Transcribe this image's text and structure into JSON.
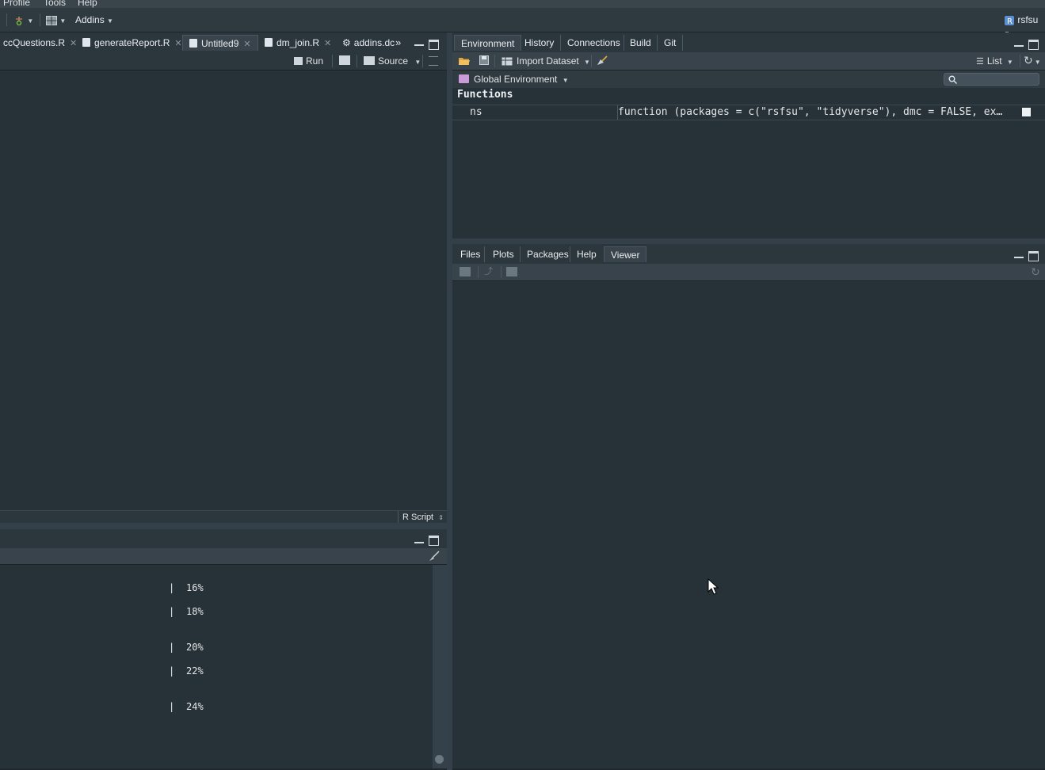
{
  "menu": {
    "items": [
      "Profile",
      "Tools",
      "Help"
    ]
  },
  "toolbar": {
    "addins_label": "Addins",
    "project_label": "rsfsu"
  },
  "source_pane": {
    "tabs": [
      {
        "label": "ccQuestions.R",
        "active": false
      },
      {
        "label": "generateReport.R",
        "active": false
      },
      {
        "label": "Untitled9",
        "active": true
      },
      {
        "label": "dm_join.R",
        "active": false
      },
      {
        "label": "addins.dc",
        "active": false
      }
    ],
    "run_label": "Run",
    "source_label": "Source",
    "file_type": "R Script"
  },
  "console_pane": {
    "lines": [
      {
        "bar": "|",
        "pct": "16%"
      },
      {
        "bar": "|",
        "pct": "18%"
      },
      {
        "bar": "|",
        "pct": "20%"
      },
      {
        "bar": "|",
        "pct": "22%"
      },
      {
        "bar": "|",
        "pct": "24%"
      }
    ]
  },
  "environment_pane": {
    "tabs": [
      "Environment",
      "History",
      "Connections",
      "Build",
      "Git"
    ],
    "active_tab": "Environment",
    "import_label": "Import Dataset",
    "view_mode": "List",
    "scope": "Global Environment",
    "section": "Functions",
    "rows": [
      {
        "name": "ns",
        "value": "function (packages = c(\"rsfsu\", \"tidyverse\"), dmc = FALSE, ex…"
      }
    ]
  },
  "viewer_pane": {
    "tabs": [
      "Files",
      "Plots",
      "Packages",
      "Help",
      "Viewer"
    ],
    "active_tab": "Viewer"
  },
  "colors": {
    "background": "#263238",
    "tabbar": "#2c363d",
    "text": "#e6e6e6"
  },
  "icons": [
    "git-icon",
    "layout-icon",
    "r-project-icon",
    "run-icon",
    "source-icon",
    "open-folder-icon",
    "save-icon",
    "import-icon",
    "broom-icon",
    "list-icon",
    "refresh-icon",
    "search-icon",
    "minimize-icon",
    "maximize-icon",
    "mouse-cursor-icon"
  ]
}
